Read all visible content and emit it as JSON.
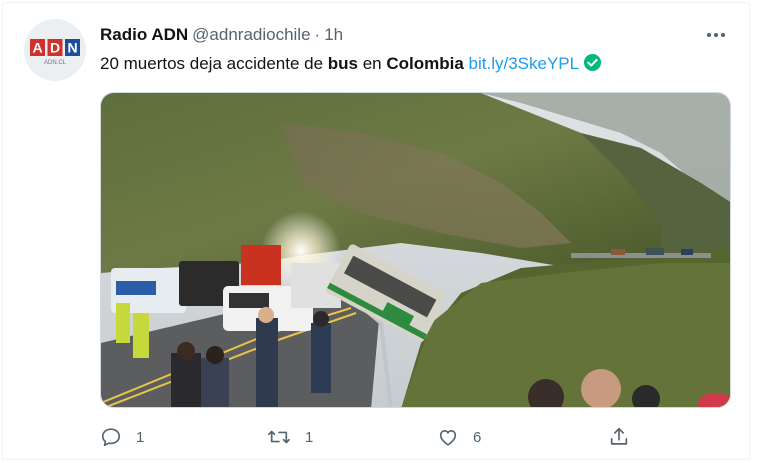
{
  "tweet": {
    "author_name": "Radio ADN",
    "handle": "@adnradiochile",
    "separator": "·",
    "time": "1h",
    "avatar_logo": "ADN",
    "avatar_sub": "ADN.CL",
    "text_parts": [
      "20 muertos deja accidente de ",
      "bus",
      " en ",
      "Colombia",
      " "
    ],
    "link_text": "bit.ly/3SkeYPL",
    "verified_icon": "verified-check-icon",
    "more_icon": "more-dots-icon",
    "media_description_icon": "photo-bus-accident",
    "actions": {
      "reply_count": "1",
      "retweet_count": "1",
      "like_count": "6",
      "share_count": ""
    }
  },
  "colors": {
    "text_primary": "#0f1419",
    "text_secondary": "#536471",
    "link": "#1d9bf0",
    "verified": "#00ba7c",
    "logo_red": "#d0312d",
    "logo_blue": "#1b4f9c"
  }
}
